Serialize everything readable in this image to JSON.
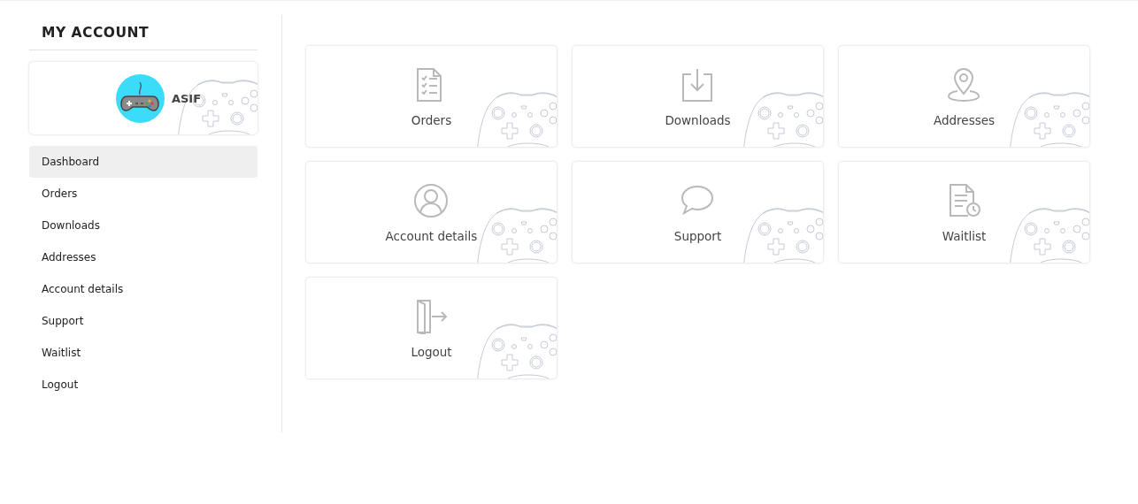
{
  "title": "MY ACCOUNT",
  "profile": {
    "name": "ASIF"
  },
  "nav": [
    {
      "label": "Dashboard",
      "selected": true
    },
    {
      "label": "Orders",
      "selected": false
    },
    {
      "label": "Downloads",
      "selected": false
    },
    {
      "label": "Addresses",
      "selected": false
    },
    {
      "label": "Account details",
      "selected": false
    },
    {
      "label": "Support",
      "selected": false
    },
    {
      "label": "Waitlist",
      "selected": false
    },
    {
      "label": "Logout",
      "selected": false
    }
  ],
  "cards": [
    {
      "label": "Orders",
      "kind": "orders"
    },
    {
      "label": "Downloads",
      "kind": "downloads"
    },
    {
      "label": "Addresses",
      "kind": "addresses"
    },
    {
      "label": "Account details",
      "kind": "account"
    },
    {
      "label": "Support",
      "kind": "support"
    },
    {
      "label": "Waitlist",
      "kind": "waitlist"
    },
    {
      "label": "Logout",
      "kind": "logout"
    }
  ]
}
